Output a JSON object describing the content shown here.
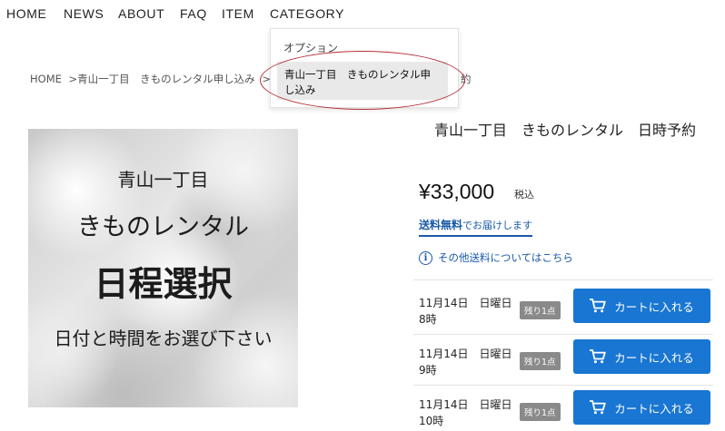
{
  "nav": [
    "HOME",
    "NEWS",
    "ABOUT",
    "FAQ",
    "ITEM",
    "CATEGORY"
  ],
  "breadcrumb": [
    "HOME",
    ">青山一丁目　きものレンタル申し込み",
    ">"
  ],
  "breadcrumb_tail": "約",
  "dropdown": {
    "header": "オプション",
    "option": "青山一丁目　きものレンタル申し込み"
  },
  "image_text": {
    "line1": "青山一丁目",
    "line2": "きものレンタル",
    "line3": "日程選択",
    "line4": "日付と時間をお選び下さい"
  },
  "product": {
    "title": "青山一丁目　きものレンタル　日時予約",
    "price": "¥33,000",
    "tax_label": "税込",
    "shipping_free": "送料無料",
    "shipping_free_suffix": "でお届けします",
    "shipping_info": "その他送料についてはこちら"
  },
  "slots": [
    {
      "date": "11月14日　日曜日",
      "time": "8時",
      "badge": "残り1点",
      "button": "カートに入れる"
    },
    {
      "date": "11月14日　日曜日",
      "time": "9時",
      "badge": "残り1点",
      "button": "カートに入れる"
    },
    {
      "date": "11月14日　日曜日",
      "time": "10時",
      "badge": "残り1点",
      "button": "カートに入れる"
    }
  ],
  "colors": {
    "accent": "#1976d2",
    "link": "#1a5aa8",
    "badge": "#8a8a8a",
    "highlight_ring": "#b3303a"
  }
}
